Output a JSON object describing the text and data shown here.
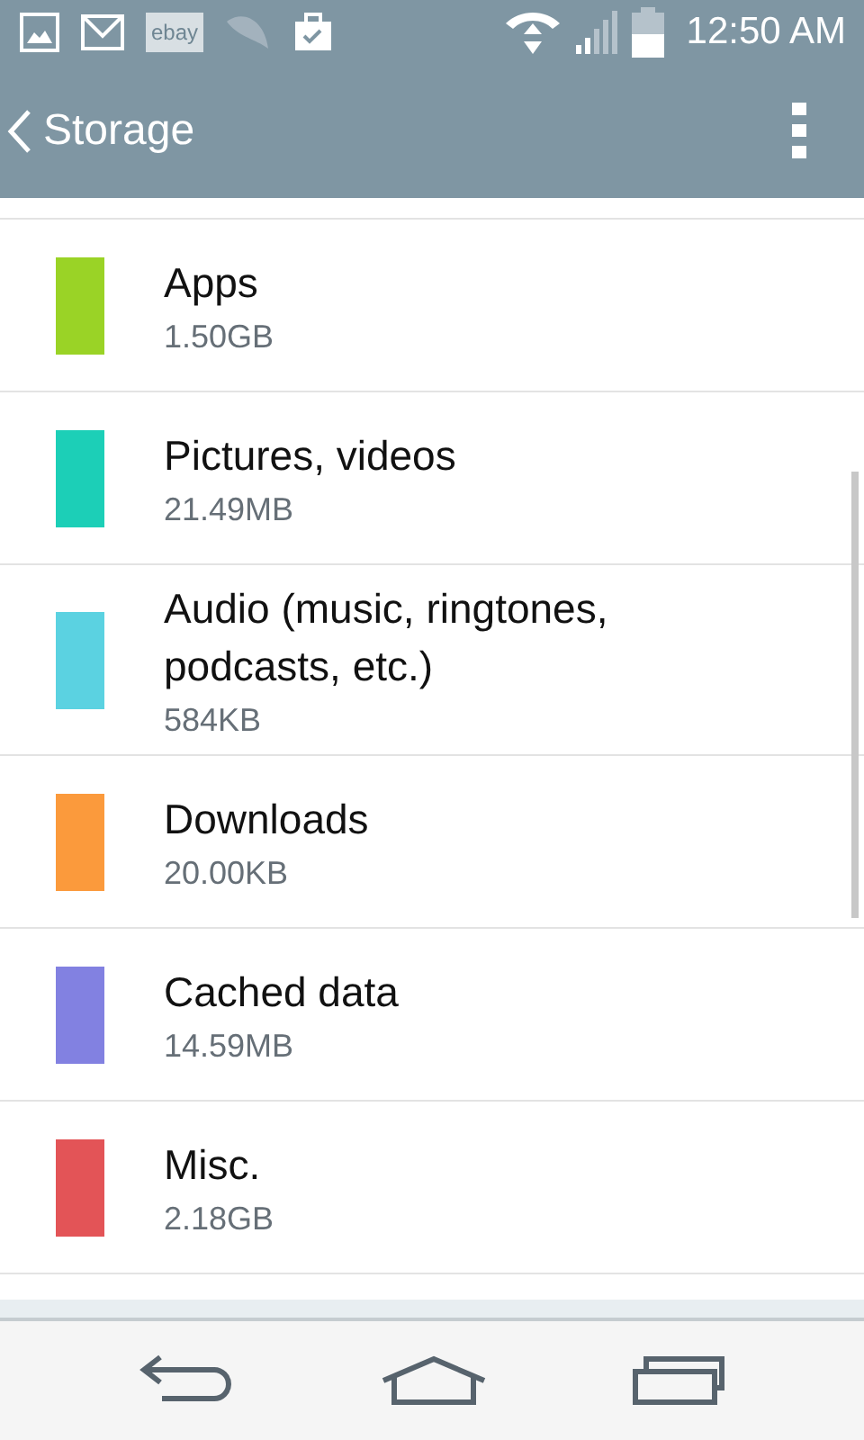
{
  "status_bar": {
    "time": "12:50 AM",
    "notification_icons": [
      {
        "kind": "picture"
      },
      {
        "kind": "mail"
      },
      {
        "kind": "ebay",
        "label": "ebay"
      },
      {
        "kind": "leaf"
      },
      {
        "kind": "briefcase"
      }
    ]
  },
  "app_bar": {
    "title": "Storage"
  },
  "items": [
    {
      "name": "Apps",
      "size": "1.50GB",
      "color": "#9ad326"
    },
    {
      "name": "Pictures, videos",
      "size": "21.49MB",
      "color": "#1ccfb7"
    },
    {
      "name": "Audio (music, ringtones, podcasts, etc.)",
      "size": "584KB",
      "color": "#5bd2e1"
    },
    {
      "name": "Downloads",
      "size": "20.00KB",
      "color": "#fb9a3c"
    },
    {
      "name": "Cached data",
      "size": "14.59MB",
      "color": "#8281e1"
    },
    {
      "name": "Misc.",
      "size": "2.18GB",
      "color": "#e35457"
    }
  ]
}
